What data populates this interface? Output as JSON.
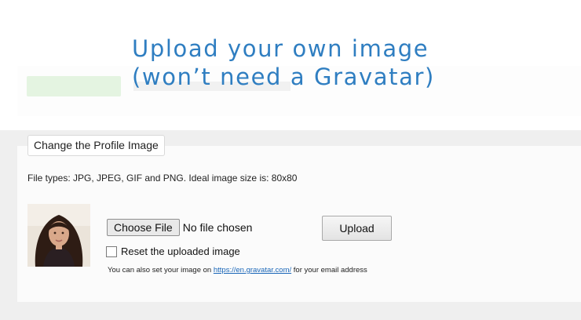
{
  "overlay": {
    "headline_line1": "Upload your own image",
    "headline_line2": "(won’t need a Gravatar)",
    "color": "#2f7ec1"
  },
  "panel": {
    "legend": "Change the Profile Image",
    "file_types_text": "File types: JPG, JPEG, GIF and PNG. Ideal image size is: 80x80",
    "avatar_icon": "profile-photo",
    "choose_file_label": "Choose File",
    "no_file_text": "No file chosen",
    "upload_label": "Upload",
    "reset_label": "Reset the uploaded image",
    "reset_checked": false,
    "note_prefix": "You can also set your image on ",
    "note_link": "https://en.gravatar.com/",
    "note_suffix": " for your email address",
    "link_color": "#1a66b8"
  }
}
